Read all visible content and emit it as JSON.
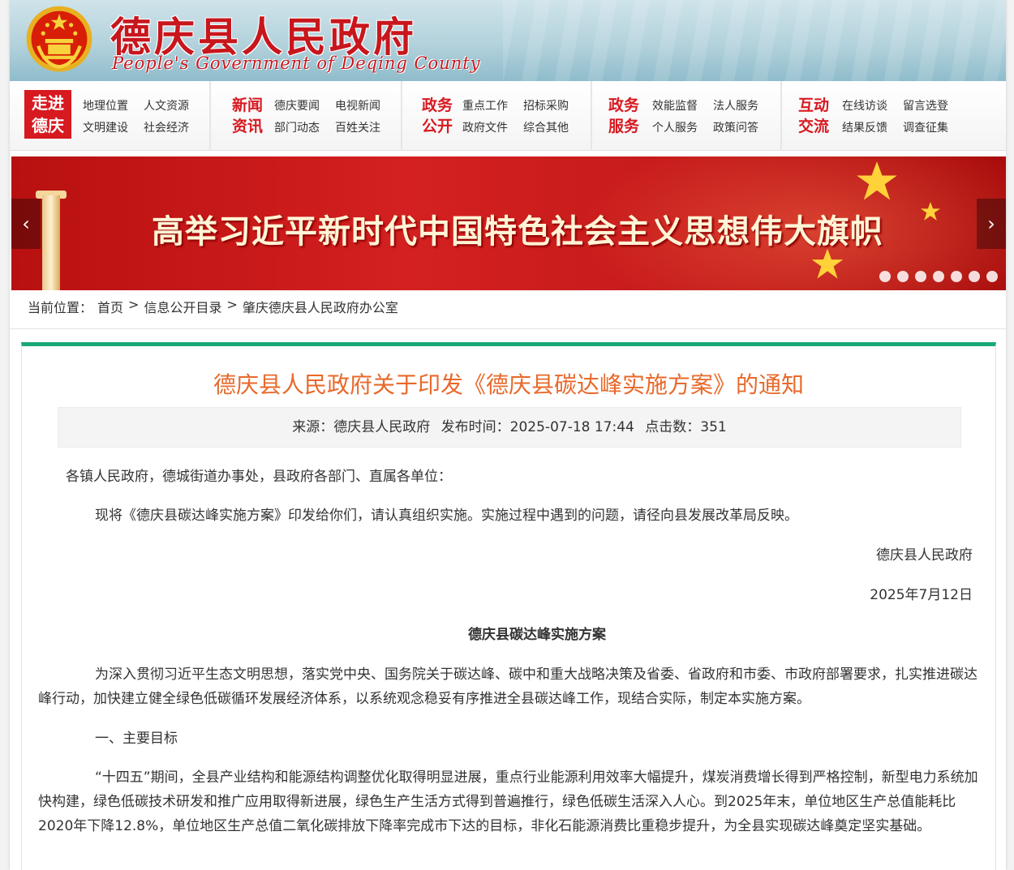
{
  "header": {
    "title": "德庆县人民政府",
    "subtitle": "People's Government of Deqing County"
  },
  "nav": {
    "badge": [
      "走进",
      "德庆"
    ],
    "groups": [
      {
        "links": [
          "地理位置",
          "人文资源",
          "文明建设",
          "社会经济"
        ]
      },
      {
        "cat": [
          "新闻",
          "资讯"
        ],
        "links": [
          "德庆要闻",
          "电视新闻",
          "部门动态",
          "百姓关注"
        ]
      },
      {
        "cat": [
          "政务",
          "公开"
        ],
        "links": [
          "重点工作",
          "招标采购",
          "政府文件",
          "综合其他"
        ]
      },
      {
        "cat": [
          "政务",
          "服务"
        ],
        "links": [
          "效能监督",
          "法人服务",
          "个人服务",
          "政策问答"
        ]
      },
      {
        "cat": [
          "互动",
          "交流"
        ],
        "links": [
          "在线访谈",
          "留言选登",
          "结果反馈",
          "调查征集"
        ]
      }
    ]
  },
  "banner": {
    "slogan": "高举习近平新时代中国特色社会主义思想伟大旗帜",
    "prev": "‹",
    "next": "›",
    "dot_count": 7
  },
  "breadcrumb": {
    "label": "当前位置：",
    "items": [
      "首页",
      "信息公开目录",
      "肇庆德庆县人民政府办公室"
    ],
    "sep": ">"
  },
  "article": {
    "title": "德庆县人民政府关于印发《德庆县碳达峰实施方案》的通知",
    "meta": {
      "source": "来源：德庆县人民政府",
      "published": "发布时间：2025-07-18 17:44",
      "clicks": "点击数：351"
    },
    "salutation": "各镇人民政府，德城街道办事处，县政府各部门、直属各单位：",
    "notice": "现将《德庆县碳达峰实施方案》印发给你们，请认真组织实施。实施过程中遇到的问题，请径向县发展改革局反映。",
    "signer": "德庆县人民政府",
    "date": "2025年7月12日",
    "plan_title": "德庆县碳达峰实施方案",
    "intro": "为深入贯彻习近平生态文明思想，落实党中央、国务院关于碳达峰、碳中和重大战略决策及省委、省政府和市委、市政府部署要求，扎实推进碳达峰行动，加快建立健全绿色低碳循环发展经济体系，以系统观念稳妥有序推进全县碳达峰工作，现结合实际，制定本实施方案。",
    "section1": "一、主要目标",
    "goals": "“十四五”期间，全县产业结构和能源结构调整优化取得明显进展，重点行业能源利用效率大幅提升，煤炭消费增长得到严格控制，新型电力系统加快构建，绿色低碳技术研发和推广应用取得新进展，绿色生产生活方式得到普遍推行，绿色低碳生活深入人心。到2025年末，单位地区生产总值能耗比2020年下降12.8%，单位地区生产总值二氧化碳排放下降率完成市下达的目标，非化石能源消费比重稳步提升，为全县实现碳达峰奠定坚实基础。"
  },
  "colors": {
    "brand_red": "#d71920",
    "title_orange": "#e8692b",
    "accent_green": "#1aa87a"
  }
}
